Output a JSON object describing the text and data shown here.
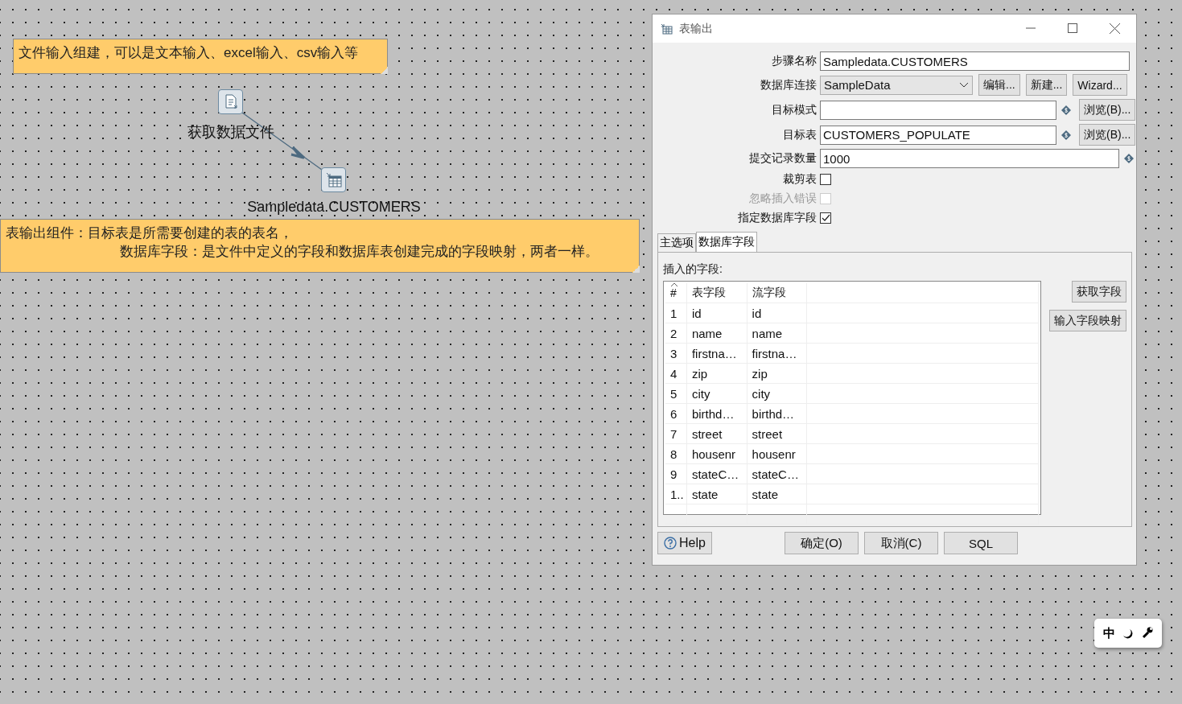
{
  "canvas": {
    "notes": [
      {
        "lines": [
          "文件输入组建，可以是文本输入、excel输入、csv输入等"
        ]
      },
      {
        "lines": [
          "表输出组件：目标表是所需要创建的表的表名，",
          "数据库字段：是文件中定义的字段和数据库表创建完成的字段映射，两者一样。"
        ]
      }
    ],
    "steps": [
      {
        "kind": "file-input",
        "label": "获取数据文件"
      },
      {
        "kind": "table-output",
        "label": "Sampledata.CUSTOMERS"
      }
    ]
  },
  "dialog": {
    "title": "表输出",
    "fields": [
      {
        "kind": "text",
        "label": "步骤名称",
        "value": "Sampledata.CUSTOMERS"
      },
      {
        "kind": "select",
        "label": "数据库连接",
        "value": "SampleData",
        "buttons": [
          "编辑...",
          "新建...",
          "Wizard..."
        ]
      },
      {
        "kind": "text",
        "label": "目标模式",
        "variable": true,
        "button": "浏览(B)..."
      },
      {
        "kind": "text",
        "label": "目标表",
        "value": "CUSTOMERS_POPULATE",
        "variable": true,
        "button": "浏览(B)..."
      },
      {
        "kind": "text",
        "label": "提交记录数量",
        "value": "1000",
        "variable": true
      },
      {
        "kind": "checkbox",
        "label": "裁剪表",
        "checked": false,
        "disabled": false
      },
      {
        "kind": "checkbox",
        "label": "忽略插入错误",
        "checked": false,
        "disabled": true
      },
      {
        "kind": "checkbox",
        "label": "指定数据库字段",
        "checked": true,
        "disabled": false
      }
    ],
    "tabs": [
      {
        "label": "主选项",
        "selected": false
      },
      {
        "label": "数据库字段",
        "selected": true
      }
    ],
    "insert_label": "插入的字段:",
    "table": {
      "columns": [
        "#",
        "表字段",
        "流字段"
      ],
      "rows": [
        [
          "1",
          "id",
          "id"
        ],
        [
          "2",
          "name",
          "name"
        ],
        [
          "3",
          "firstna…",
          "firstna…"
        ],
        [
          "4",
          "zip",
          "zip"
        ],
        [
          "5",
          "city",
          "city"
        ],
        [
          "6",
          "birthd…",
          "birthd…"
        ],
        [
          "7",
          "street",
          "street"
        ],
        [
          "8",
          "housenr",
          "housenr"
        ],
        [
          "9",
          "stateC…",
          "stateC…"
        ],
        [
          "1..",
          "state",
          "state"
        ]
      ]
    },
    "side_buttons": [
      "获取字段",
      "输入字段映射"
    ],
    "help": "Help",
    "buttons": [
      "确定(O)",
      "取消(C)",
      "SQL"
    ]
  },
  "ime_toolbar": {
    "mode": "中"
  }
}
